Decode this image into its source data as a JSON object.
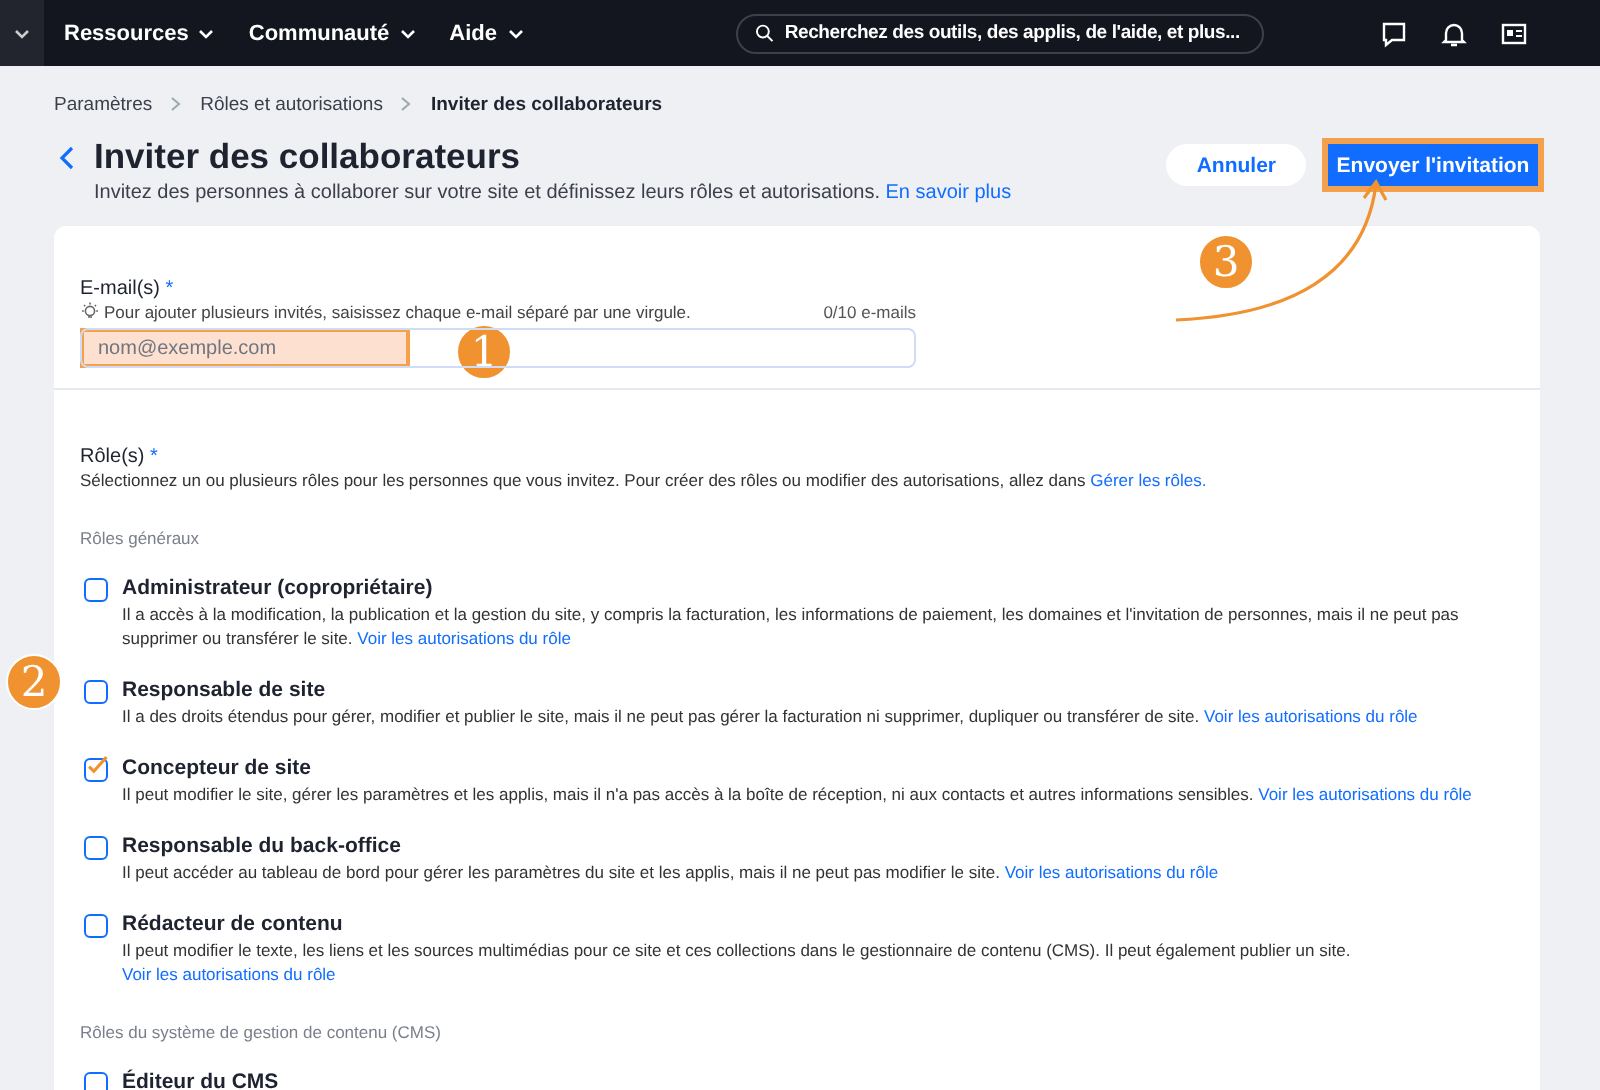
{
  "topbar": {
    "menus": [
      {
        "label": "Ressources"
      },
      {
        "label": "Communauté"
      },
      {
        "label": "Aide"
      }
    ],
    "search": {
      "placeholder": "Recherchez des outils, des applis, de l'aide, et plus..."
    }
  },
  "breadcrumb": [
    "Paramètres",
    "Rôles et autorisations",
    "Inviter des collaborateurs"
  ],
  "header": {
    "title": "Inviter des collaborateurs",
    "subtitle": "Invitez des personnes à collaborer sur votre site et définissez leurs rôles et autorisations.",
    "link": "En savoir plus",
    "buttons": [
      {
        "label": "Annuler",
        "kind": "secondary"
      },
      {
        "label": "Envoyer l'invitation",
        "kind": "primary"
      }
    ]
  },
  "email": {
    "label": "E-mail(s)",
    "required": "*",
    "hint": "Pour ajouter plusieurs invités, saisissez chaque e-mail séparé par une virgule.",
    "counter": "0/10 e-mails",
    "placeholder": "nom@exemple.com"
  },
  "roles": {
    "label": "Rôle(s)",
    "required": "*",
    "description": "Sélectionnez un ou plusieurs rôles pour les personnes que vous invitez. Pour créer des rôles ou modifier des autorisations, allez dans",
    "link": "Gérer les rôles.",
    "groups": [
      {
        "title": "Rôles généraux",
        "items": [
          {
            "title": "Administrateur (copropriétaire)",
            "description": "Il a accès à la modification, la publication et la gestion du site, y compris la facturation, les informations de paiement, les domaines et l'invitation de personnes, mais il ne peut pas supprimer ou transférer le site.",
            "link": "Voir les autorisations du rôle",
            "checked": false
          },
          {
            "title": "Responsable de site",
            "description": "Il a des droits étendus pour gérer, modifier et publier le site, mais il ne peut pas gérer la facturation ni supprimer, dupliquer ou transférer de site.",
            "link": "Voir les autorisations du rôle",
            "checked": false
          },
          {
            "title": "Concepteur de site",
            "description": "Il peut modifier le site, gérer les paramètres et les applis, mais il n'a pas accès à la boîte de réception, ni aux contacts et autres informations sensibles.",
            "link": "Voir les autorisations du rôle",
            "checked": true
          },
          {
            "title": "Responsable du back-office",
            "description": "Il peut accéder au tableau de bord pour gérer les paramètres du site et les applis, mais il ne peut pas modifier le site.",
            "link": "Voir les autorisations du rôle",
            "checked": false
          },
          {
            "title": "Rédacteur de contenu",
            "description": "Il peut modifier le texte, les liens et les sources multimédias pour ce site et ces collections dans le gestionnaire de contenu (CMS). Il peut également publier un site.",
            "link": "Voir les autorisations du rôle",
            "checked": false
          }
        ]
      },
      {
        "title": "Rôles du système de gestion de contenu (CMS)",
        "items": [
          {
            "title": "Éditeur du CMS",
            "checked": false
          }
        ]
      }
    ]
  },
  "annotations": [
    {
      "number": "1"
    },
    {
      "number": "2"
    },
    {
      "number": "3"
    }
  ]
}
